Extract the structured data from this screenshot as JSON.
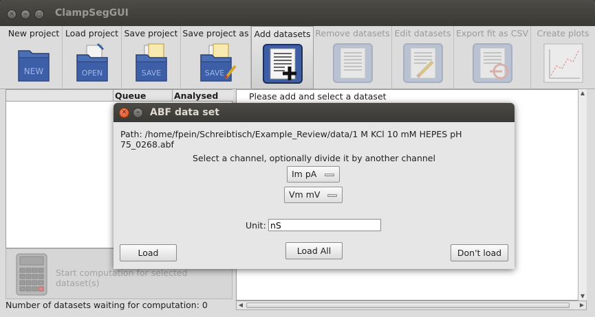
{
  "window": {
    "title": "ClampSegGUI",
    "close_glyph": "✕",
    "minimize_glyph": "–",
    "maximize_glyph": "□"
  },
  "toolbar": {
    "buttons": [
      {
        "label": "New project",
        "icon": "new-project-icon",
        "icon_text": "NEW",
        "enabled": true
      },
      {
        "label": "Load project",
        "icon": "open-project-icon",
        "icon_text": "OPEN",
        "enabled": true
      },
      {
        "label": "Save project",
        "icon": "save-project-icon",
        "icon_text": "SAVE",
        "enabled": true
      },
      {
        "label": "Save project as",
        "icon": "save-as-project-icon",
        "icon_text": "SAVE",
        "enabled": true
      },
      {
        "label": "Add datasets",
        "icon": "add-datasets-icon",
        "enabled": true
      },
      {
        "label": "Remove datasets",
        "icon": "remove-datasets-icon",
        "enabled": false
      },
      {
        "label": "Edit datasets",
        "icon": "edit-datasets-icon",
        "enabled": false
      },
      {
        "label": "Export fit as CSV",
        "icon": "export-csv-icon",
        "enabled": false
      },
      {
        "label": "Create plots",
        "icon": "create-plots-icon",
        "enabled": false
      }
    ]
  },
  "dataset_table": {
    "columns": [
      "",
      "Queue",
      "Analysed"
    ]
  },
  "computation": {
    "label": "Start computation for selected dataset(s)",
    "icon": "calculator-icon"
  },
  "status": {
    "text": "Number of datasets waiting for computation: 0"
  },
  "right_panel": {
    "message": "Please add and select a dataset"
  },
  "dialog": {
    "title": "ABF data set",
    "close_glyph": "✕",
    "minimize_glyph": "–",
    "path": "Path: /home/fpein/Schreibtisch/Example_Review/data/1 M KCl 10 mM HEPES pH 75_0268.abf",
    "instruction": "Select a channel, optionally divide it by another channel",
    "channel_select": "Im pA",
    "divide_select": "Vm mV",
    "unit_label": "Unit:",
    "unit_value": "nS",
    "load_button": "Load",
    "load_all_button": "Load All",
    "dont_load_button": "Don't load"
  },
  "colors": {
    "titlebar": "#3c3b37",
    "window_bg": "#dcdcdc",
    "close_button": "#e0561f",
    "disabled_text": "#9a9a9a"
  }
}
